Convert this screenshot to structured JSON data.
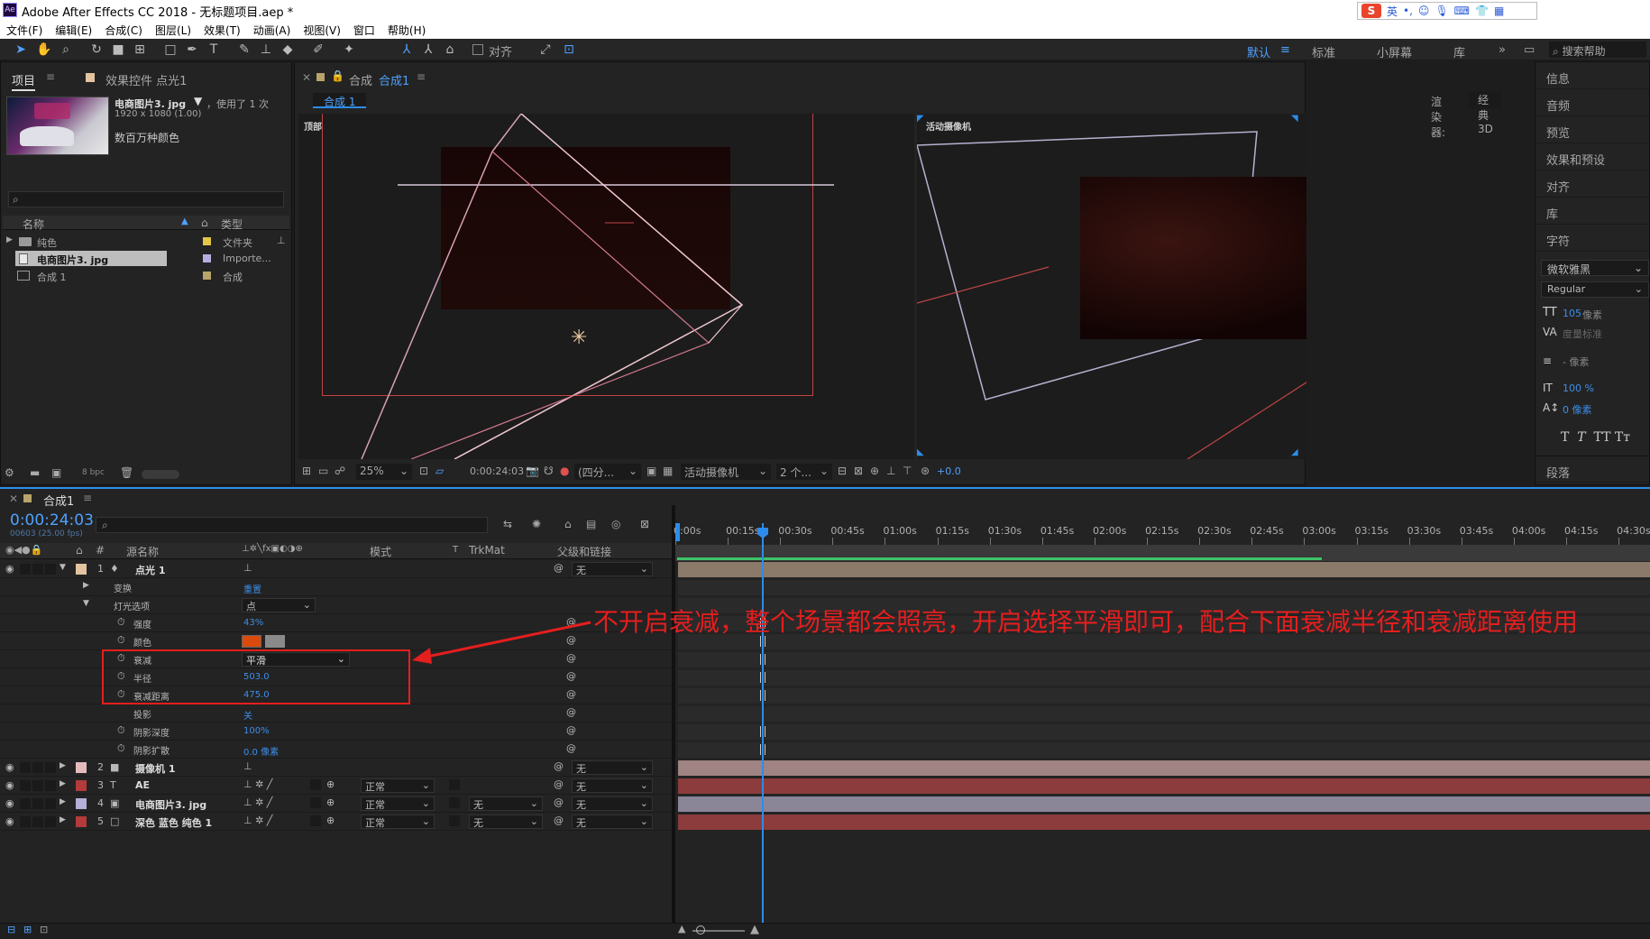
{
  "window": {
    "title": "Adobe After Effects CC 2018 - 无标题项目.aep *",
    "app_icon": "Ae"
  },
  "ime": {
    "logo": "S",
    "lang": "英",
    "punct": "•,",
    "items": [
      "emoji-icon",
      "mic-icon",
      "keyboard-icon",
      "shirt-icon",
      "grid-icon"
    ]
  },
  "menu": [
    "文件(F)",
    "编辑(E)",
    "合成(C)",
    "图层(L)",
    "效果(T)",
    "动画(A)",
    "视图(V)",
    "窗口",
    "帮助(H)"
  ],
  "toolbar": {
    "align_label": "对齐",
    "workspaces": [
      "默认",
      "标准",
      "小屏幕",
      "库"
    ],
    "search_help": "搜索帮助"
  },
  "project": {
    "tab": "项目",
    "effects_tab": "效果控件 点光1",
    "preview": {
      "filename": "电商图片3. jpg",
      "used": "，使用了 1 次",
      "dims": "1920 x 1080 (1.00)",
      "colors": "数百万种颜色"
    },
    "search_placeholder": "",
    "col_name": "名称",
    "col_type": "类型",
    "items": [
      {
        "name": "纯色",
        "type": "文件夹",
        "swatch": "#e3c64a"
      },
      {
        "name": "电商图片3. jpg",
        "type": "Importe...",
        "swatch": "#b7aee0"
      },
      {
        "name": "合成 1",
        "type": "合成",
        "swatch": "#b8a46a"
      }
    ],
    "bpc": "8 bpc"
  },
  "composition": {
    "tab": "合成",
    "tab_name": "合成1",
    "subtab": "合成 1",
    "renderer_label": "渲染器:",
    "renderer": "经典 3D",
    "view_left": "顶部",
    "view_right": "活动摄像机",
    "zoom": "25%",
    "timecode": "0:00:24:03",
    "resolution": "(四分...",
    "camera": "活动摄像机",
    "views": "2 个...",
    "exposure": "+0.0"
  },
  "right_panel": {
    "items": [
      "信息",
      "音频",
      "预览",
      "效果和预设",
      "对齐",
      "库",
      "字符"
    ],
    "font": "微软雅黑",
    "style": "Regular",
    "size": "105",
    "size_unit": "像素",
    "tracking": "度量标准",
    "leading": "- 像素",
    "vscale": "100 %",
    "baseline": "0 像素",
    "paragraph": "段落"
  },
  "timeline": {
    "tab": "合成1",
    "timecode": "0:00:24:03",
    "fps": "00603 (25.00 fps)",
    "col_source": "源名称",
    "col_mode": "模式",
    "col_t": "T",
    "col_trkmat": "TrkMat",
    "col_parent": "父级和链接",
    "ruler": [
      "0:00s",
      "00:15s",
      "00:30s",
      "00:45s",
      "01:00s",
      "01:15s",
      "01:30s",
      "01:45s",
      "02:00s",
      "02:15s",
      "02:30s",
      "02:45s",
      "03:00s",
      "03:15s",
      "03:30s",
      "03:45s",
      "04:00s",
      "04:15s",
      "04:30s"
    ],
    "rows": [
      {
        "num": "1",
        "name": "点光 1",
        "parent": "无",
        "color": "#e3c3a0",
        "kind": "layer",
        "bar": "#8b7a6a"
      },
      {
        "name": "变换",
        "value": "重置",
        "kind": "group"
      },
      {
        "name": "灯光选项",
        "value": "点",
        "kind": "group2"
      },
      {
        "name": "强度",
        "value": "43%",
        "kind": "prop"
      },
      {
        "name": "颜色",
        "value": "",
        "kind": "color"
      },
      {
        "name": "衰减",
        "value": "平滑",
        "kind": "dropdown"
      },
      {
        "name": "半径",
        "value": "503.0",
        "kind": "prop"
      },
      {
        "name": "衰减距离",
        "value": "475.0",
        "kind": "prop"
      },
      {
        "name": "投影",
        "value": "关",
        "kind": "propnostop"
      },
      {
        "name": "阴影深度",
        "value": "100%",
        "kind": "prop"
      },
      {
        "name": "阴影扩散",
        "value": "0.0 像素",
        "kind": "prop"
      },
      {
        "num": "2",
        "name": "摄像机 1",
        "parent": "无",
        "color": "#e4bcbc",
        "kind": "layer",
        "bar": "#a08383"
      },
      {
        "num": "3",
        "name": "AE",
        "mode": "正常",
        "parent": "无",
        "color": "#b33b3b",
        "kind": "layer",
        "bar": "#8c3c3c"
      },
      {
        "num": "4",
        "name": "电商图片3. jpg",
        "mode": "正常",
        "trkmat": "无",
        "parent": "无",
        "color": "#b4aed8",
        "kind": "layer",
        "bar": "#8a8698"
      },
      {
        "num": "5",
        "name": "深色 蓝色 纯色 1",
        "mode": "正常",
        "trkmat": "无",
        "parent": "无",
        "color": "#b33b3b",
        "kind": "layer",
        "bar": "#8c3c3c"
      }
    ]
  },
  "annotation": "不开启衰减，整个场景都会照亮，开启选择平滑即可，配合下面衰减半径和衰减距离使用",
  "colors": {
    "accent": "#2d8ceb",
    "annotation_red": "#e51e1e",
    "light_color_swatch": "#d94a0c"
  }
}
